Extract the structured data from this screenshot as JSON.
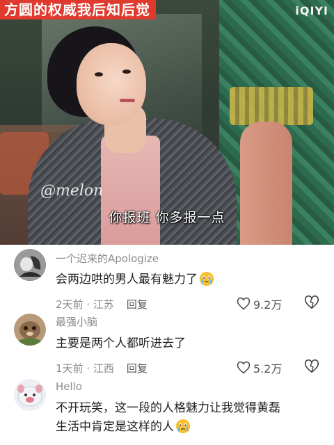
{
  "video": {
    "title_caption": "方圆的权威我后知后觉",
    "platform_logo": "iQIYI",
    "watermark": "@melon",
    "subtitle": "你报班 你多报一点"
  },
  "comments": [
    {
      "username": "一个迟来的Apologize",
      "text": "会两边哄的男人最有魅力了",
      "emoji": "crying-face-emoji",
      "time": "2天前",
      "location": "江苏",
      "reply_label": "回复",
      "likes": "9.2万"
    },
    {
      "username": "最强小脑",
      "text": "主要是两个人都听进去了",
      "time": "1天前",
      "location": "江西",
      "reply_label": "回复",
      "likes": "5.2万"
    },
    {
      "username": "Hello",
      "text_line1": "不开玩笑，这一段的人格魅力让我觉得黄磊",
      "text_line2": "生活中肯定是这样的人",
      "emoji": "crying-face-emoji"
    }
  ],
  "meta_separator": " · ",
  "colors": {
    "title_bg": "#e03a2e",
    "meta_text": "#8a8a8a",
    "body_text": "#1f1f1f"
  }
}
